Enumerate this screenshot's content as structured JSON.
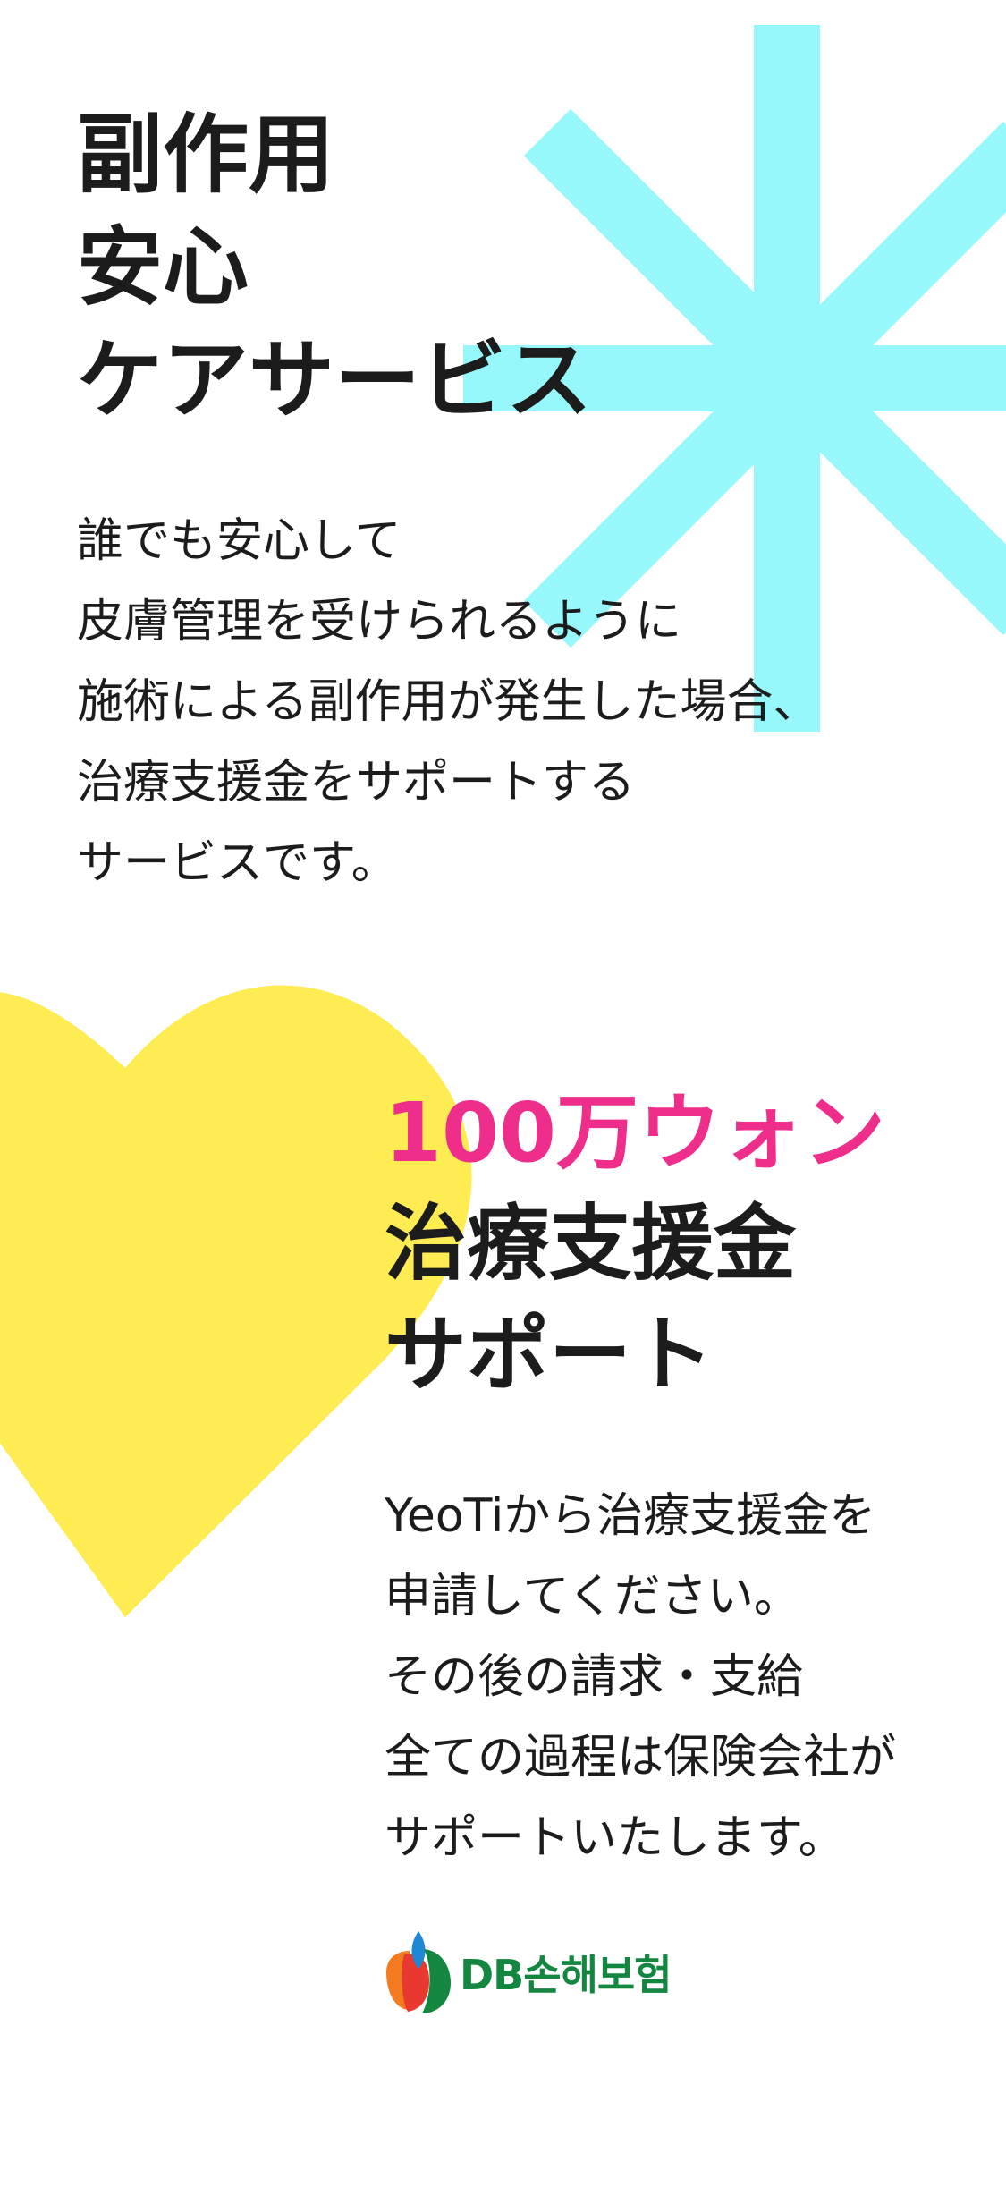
{
  "colors": {
    "asterisk": "#97f8fc",
    "heart": "#ffeb52",
    "accent_pink": "#ee2e8a",
    "text_dark": "#1c1c1c",
    "logo_green": "#13873f",
    "logo_orange": "#f47b20",
    "logo_red": "#e8382f",
    "logo_blue": "#1e88d6"
  },
  "decorations": {
    "asterisk_icon": "asterisk-icon",
    "heart_icon": "heart-icon"
  },
  "intro": {
    "title_lines": [
      "副作用",
      "安心",
      "ケアサービス"
    ],
    "body_lines": [
      "誰でも安心して",
      "皮膚管理を受けられるように",
      "施術による副作用が発生した場合、",
      "治療支援金をサポートする",
      "サービスです。"
    ]
  },
  "support": {
    "highlight": "100万ウォン",
    "title_lines": [
      "治療支援金",
      "サポート"
    ],
    "body_lines": [
      "YeoTiから治療支援金を",
      "申請してください。",
      "その後の請求・支給",
      "全ての過程は保険会社が",
      "サポートいたします。"
    ]
  },
  "insurer": {
    "logo_text": "DB손해보험"
  }
}
